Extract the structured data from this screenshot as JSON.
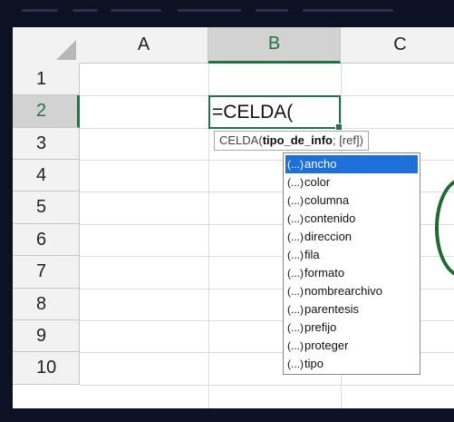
{
  "columns": [
    "A",
    "B",
    "C"
  ],
  "rows": [
    "1",
    "2",
    "3",
    "4",
    "5",
    "6",
    "7",
    "8",
    "9",
    "10"
  ],
  "active_column": "B",
  "active_row": "2",
  "active_cell": {
    "formula": "=CELDA("
  },
  "tooltip": {
    "fn": "CELDA(",
    "arg_bold": "tipo_de_info",
    "rest": "; [ref])"
  },
  "dropdown": {
    "icon": "(...)",
    "selected_index": 0,
    "items": [
      "ancho",
      "color",
      "columna",
      "contenido",
      "direccion",
      "fila",
      "formato",
      "nombrearchivo",
      "parentesis",
      "prefijo",
      "proteger",
      "tipo"
    ]
  },
  "colors": {
    "accent_green": "#217346",
    "selection_blue": "#1e6fd9",
    "background": "#0d1124"
  }
}
